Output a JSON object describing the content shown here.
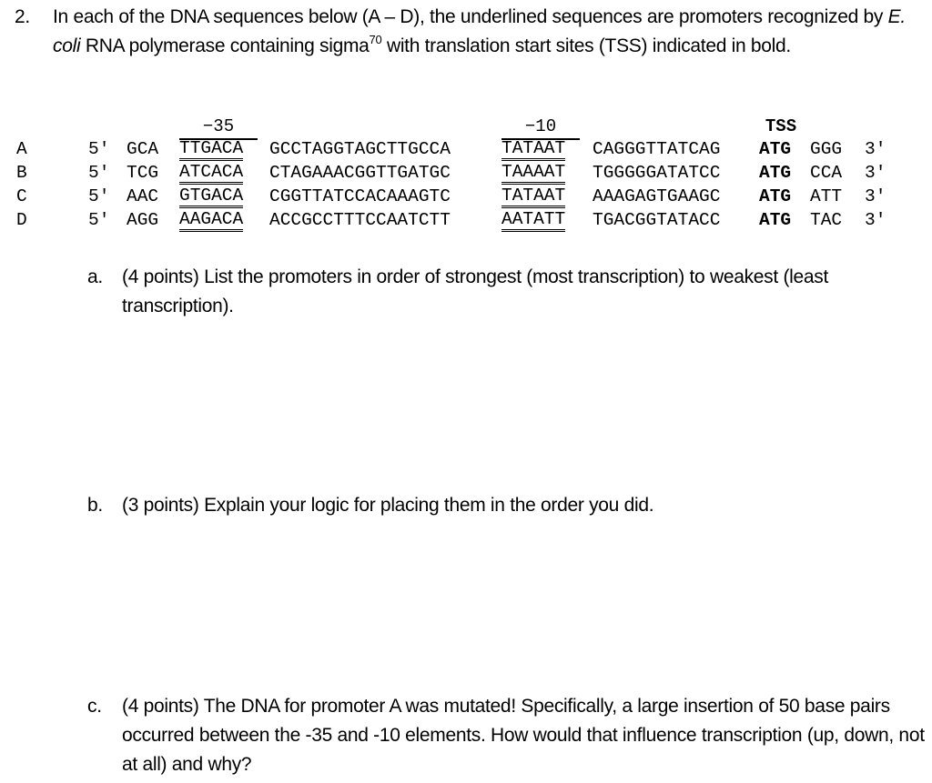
{
  "question": {
    "number": "2.",
    "intro_part1": "In each of the DNA sequences below (A – D), the underlined sequences are promoters recognized by ",
    "intro_italic": "E. coli",
    "intro_part2": " RNA polymerase containing sigma",
    "intro_superscript": "70",
    "intro_part3": " with translation start sites (TSS) indicated in bold."
  },
  "sequence_headers": {
    "minus35": "−35",
    "minus10": "−10",
    "tss": "TSS"
  },
  "sequences": [
    {
      "label": "A",
      "five_prime": "5′",
      "upstream": "GCA",
      "minus35": "TTGACA",
      "spacer": "GCCTAGGTAGCTTGCCA",
      "minus10": "TATAAT",
      "spacer2": "CAGGGTTATCAG",
      "start": "ATG",
      "downstream": "GGG",
      "three_prime": "3′"
    },
    {
      "label": "B",
      "five_prime": "5′",
      "upstream": "TCG",
      "minus35": "ATCACA",
      "spacer": "CTAGAAACGGTTGATGC",
      "minus10": "TAAAAT",
      "spacer2": "TGGGGGATATCC",
      "start": "ATG",
      "downstream": "CCA",
      "three_prime": "3′"
    },
    {
      "label": "C",
      "five_prime": "5′",
      "upstream": "AAC",
      "minus35": "GTGACA",
      "spacer": "CGGTTATCCACAAAGTC",
      "minus10": "TATAAT",
      "spacer2": "AAAGAGTGAAGC",
      "start": "ATG",
      "downstream": "ATT",
      "three_prime": "3′"
    },
    {
      "label": "D",
      "five_prime": "5′",
      "upstream": "AGG",
      "minus35": "AAGACA",
      "spacer": "ACCGCCTTTCCAATCTT",
      "minus10": "AATATT",
      "spacer2": "TGACGGTATACC",
      "start": "ATG",
      "downstream": "TAC",
      "three_prime": "3′"
    }
  ],
  "subquestions": [
    {
      "letter": "a.",
      "text": "(4 points) List the promoters in order of strongest (most transcription) to weakest (least transcription)."
    },
    {
      "letter": "b.",
      "text": "(3 points) Explain your logic for placing them in the order you did."
    },
    {
      "letter": "c.",
      "text": "(4 points) The DNA for promoter A was mutated! Specifically, a large insertion of 50 base pairs occurred between the -35 and -10 elements. How would that influence transcription (up, down, not at all) and why?"
    }
  ]
}
